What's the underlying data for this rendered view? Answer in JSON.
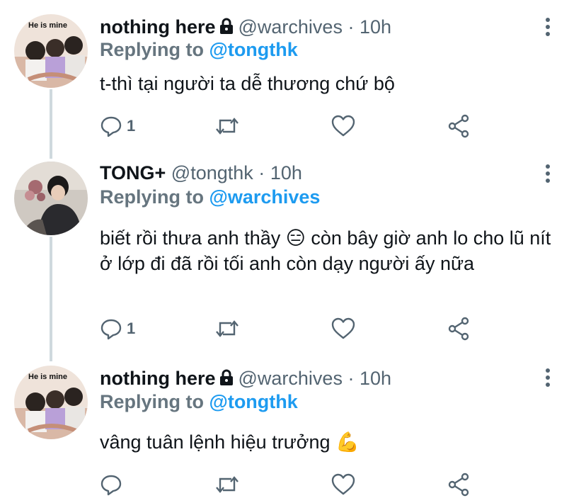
{
  "tweets": [
    {
      "name": "nothing here",
      "handle": "@warchives",
      "dot": "·",
      "time": "10h",
      "replying_prefix": "Replying to ",
      "replying_to": "@tongthk",
      "text": "t-thì tại người ta dễ thương chứ bộ",
      "reply_count": "1",
      "locked": true,
      "avatar_caption": "He is mine"
    },
    {
      "name": "TONG+",
      "handle": "@tongthk",
      "dot": "·",
      "time": "10h",
      "replying_prefix": "Replying to ",
      "replying_to": "@warchives",
      "text": "biết rồi thưa anh thầy 😑  còn bây giờ anh lo cho lũ nít ở lớp đi đã rồi tối anh còn dạy người ấy nữa",
      "reply_count": "1",
      "locked": false
    },
    {
      "name": "nothing here",
      "handle": "@warchives",
      "dot": "·",
      "time": "10h",
      "replying_prefix": "Replying to ",
      "replying_to": "@tongthk",
      "text": "vâng tuân lệnh hiệu trưởng 💪",
      "reply_count": "",
      "locked": true,
      "avatar_caption": "He is mine"
    }
  ],
  "colors": {
    "text": "#0f1419",
    "secondary": "#536471",
    "mention": "#1d9bf0",
    "thread_line": "#cfd9de"
  },
  "icons": [
    "reply-icon",
    "retweet-icon",
    "like-icon",
    "share-icon",
    "more-icon",
    "lock-icon"
  ]
}
